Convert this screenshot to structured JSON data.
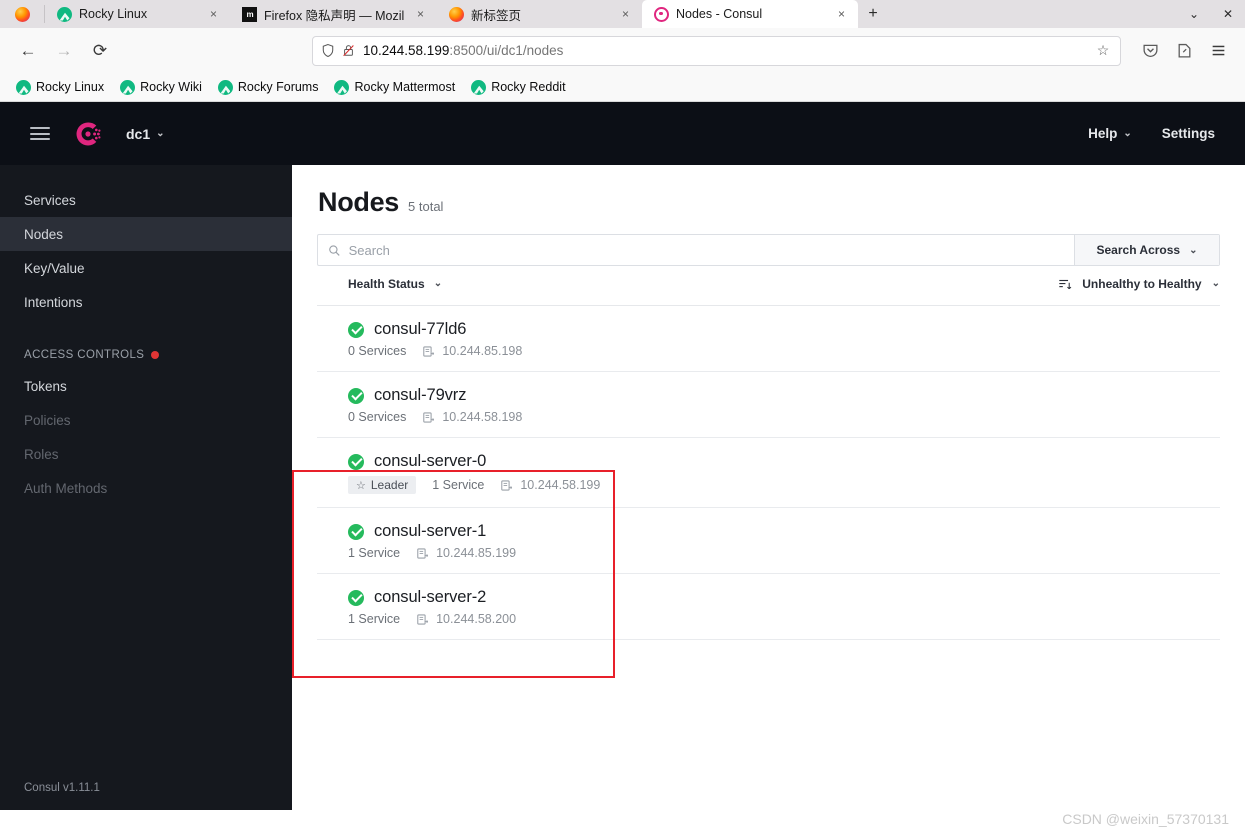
{
  "browser": {
    "tabs": [
      {
        "title": "Rocky Linux",
        "favicon": "rocky-icon",
        "active": false,
        "close_label": "×"
      },
      {
        "title": "Firefox 隐私声明 — Mozil",
        "favicon": "mozilla-icon",
        "active": false,
        "close_label": "×"
      },
      {
        "title": "新标签页",
        "favicon": "firefox-icon",
        "active": false,
        "close_label": "×"
      },
      {
        "title": "Nodes - Consul",
        "favicon": "consul-icon",
        "active": true,
        "close_label": "×"
      }
    ],
    "new_tab_label": "+",
    "tab_list_label": "⌄",
    "window_close_label": "✕",
    "nav": {
      "back_label": "←",
      "forward_label": "→",
      "reload_label": "⟳",
      "bookmark_star_label": "☆"
    },
    "url": {
      "host": "10.244.58.199",
      "path": ":8500/ui/dc1/nodes",
      "full": "10.244.58.199:8500/ui/dc1/nodes"
    },
    "toolbar_right": {
      "pocket_label": "pocket-icon",
      "save_label": "save-to-pocket-icon",
      "menu_label": "≡"
    },
    "bookmarks": [
      {
        "label": "Rocky Linux"
      },
      {
        "label": "Rocky Wiki"
      },
      {
        "label": "Rocky Forums"
      },
      {
        "label": "Rocky Mattermost"
      },
      {
        "label": "Rocky Reddit"
      }
    ]
  },
  "consul": {
    "header": {
      "menu_label": "menu-icon",
      "logo_label": "consul-logo",
      "datacenter": "dc1",
      "datacenter_caret": "⌄",
      "help_label": "Help",
      "help_caret": "⌄",
      "settings_label": "Settings"
    },
    "sidebar": {
      "items": [
        {
          "label": "Services",
          "state": "normal"
        },
        {
          "label": "Nodes",
          "state": "active"
        },
        {
          "label": "Key/Value",
          "state": "normal"
        },
        {
          "label": "Intentions",
          "state": "normal"
        }
      ],
      "group_label": "ACCESS CONTROLS",
      "acl_items": [
        {
          "label": "Tokens",
          "state": "normal"
        },
        {
          "label": "Policies",
          "state": "muted"
        },
        {
          "label": "Roles",
          "state": "muted"
        },
        {
          "label": "Auth Methods",
          "state": "muted"
        }
      ],
      "version": "Consul v1.11.1"
    },
    "page": {
      "title": "Nodes",
      "subtitle": "5 total",
      "search_placeholder": "Search",
      "search_value": "",
      "search_icon": "search-icon",
      "search_across_label": "Search Across",
      "search_across_caret": "⌄",
      "health_filter_label": "Health Status",
      "health_filter_caret": "⌄",
      "sort_icon": "sort-icon",
      "sort_label": "Unhealthy to Healthy",
      "sort_caret": "⌄"
    },
    "nodes": [
      {
        "name": "consul-77ld6",
        "health": "passing",
        "leader": false,
        "leader_label": "",
        "services": "0 Services",
        "ip": "10.244.85.198",
        "highlighted": false
      },
      {
        "name": "consul-79vrz",
        "health": "passing",
        "leader": false,
        "leader_label": "",
        "services": "0 Services",
        "ip": "10.244.58.198",
        "highlighted": false
      },
      {
        "name": "consul-server-0",
        "health": "passing",
        "leader": true,
        "leader_label": "Leader",
        "services": "1 Service",
        "ip": "10.244.58.199",
        "highlighted": true
      },
      {
        "name": "consul-server-1",
        "health": "passing",
        "leader": false,
        "leader_label": "",
        "services": "1 Service",
        "ip": "10.244.85.199",
        "highlighted": true
      },
      {
        "name": "consul-server-2",
        "health": "passing",
        "leader": false,
        "leader_label": "",
        "services": "1 Service",
        "ip": "10.244.58.200",
        "highlighted": true
      }
    ]
  },
  "watermark": "CSDN @weixin_57370131",
  "colors": {
    "consul_pink": "#e0267f",
    "health_green": "#25ba5d",
    "annotation_red": "#e8202a",
    "header_dark": "#0c0f16",
    "sidebar_dark": "#15181e",
    "acl_dot_red": "#e03535"
  }
}
